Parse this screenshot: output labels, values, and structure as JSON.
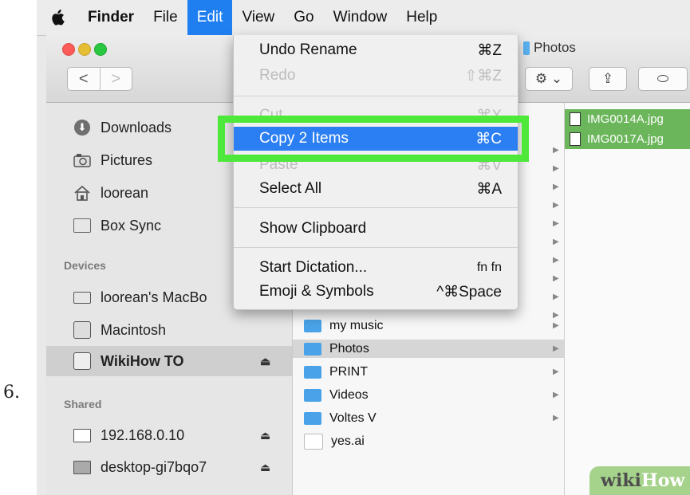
{
  "step_number": "6.",
  "menubar": {
    "apple": "",
    "items": [
      "Finder",
      "File",
      "Edit",
      "View",
      "Go",
      "Window",
      "Help"
    ]
  },
  "window": {
    "title": "Photos",
    "nav_back": "<",
    "nav_forward": ">",
    "action_button": "⚙ ⌄",
    "share_button": "⇪",
    "tag_button": "⬭"
  },
  "sidebar": {
    "favorites": [
      {
        "label": "Downloads",
        "icon": "download-icon"
      },
      {
        "label": "Pictures",
        "icon": "camera-icon"
      },
      {
        "label": "loorean",
        "icon": "home-icon"
      },
      {
        "label": "Box Sync",
        "icon": "folder-icon"
      }
    ],
    "devices_header": "Devices",
    "devices": [
      {
        "label": "loorean's MacBo",
        "icon": "laptop-icon"
      },
      {
        "label": "Macintosh",
        "icon": "drive-icon"
      },
      {
        "label": "WikiHow TO",
        "icon": "drive-icon",
        "eject": "⏏"
      }
    ],
    "shared_header": "Shared",
    "shared": [
      {
        "label": "192.168.0.10",
        "icon": "monitor-icon",
        "eject": "⏏"
      },
      {
        "label": "desktop-gi7bqo7",
        "icon": "monitor-icon",
        "eject": "⏏"
      }
    ]
  },
  "column2": {
    "items": [
      "my music",
      "Photos",
      "PRINT",
      "Videos",
      "Voltes V",
      "yes.ai"
    ],
    "selected": "Photos"
  },
  "column3": {
    "files": [
      "IMG0014A.jpg",
      "IMG0017A.jpg"
    ]
  },
  "edit_menu": {
    "items": [
      {
        "label": "Undo Rename",
        "shortcut": "⌘Z",
        "state": "enabled"
      },
      {
        "label": "Redo",
        "shortcut": "⇧⌘Z",
        "state": "disabled"
      },
      {
        "label": "Cut",
        "shortcut": "⌘X",
        "state": "disabled"
      },
      {
        "label": "Copy 2 Items",
        "shortcut": "⌘C",
        "state": "highlighted"
      },
      {
        "label": "Paste",
        "shortcut": "⌘V",
        "state": "disabled"
      },
      {
        "label": "Select All",
        "shortcut": "⌘A",
        "state": "enabled"
      },
      {
        "label": "Show Clipboard",
        "shortcut": "",
        "state": "enabled"
      },
      {
        "label": "Start Dictation...",
        "shortcut": "fn fn",
        "state": "enabled"
      },
      {
        "label": "Emoji & Symbols",
        "shortcut": "^⌘Space",
        "state": "enabled"
      }
    ]
  },
  "watermark": {
    "part1": "wiki",
    "part2": "How"
  },
  "colors": {
    "menu_highlight": "#2c7ff2",
    "callout_green": "#4ee83a",
    "file_selection": "#6bb65a"
  }
}
